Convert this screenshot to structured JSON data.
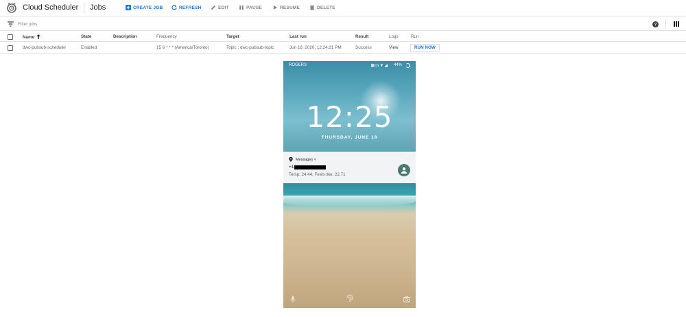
{
  "header": {
    "product_name": "Cloud Scheduler",
    "page_title": "Jobs",
    "actions": {
      "create": "CREATE JOB",
      "refresh": "REFRESH",
      "edit": "EDIT",
      "pause": "PAUSE",
      "resume": "RESUME",
      "delete": "DELETE"
    }
  },
  "filter": {
    "placeholder": "Filter jobs"
  },
  "table": {
    "columns": {
      "name": "Name",
      "state": "State",
      "description": "Description",
      "frequency": "Frequency",
      "target": "Target",
      "last_run": "Last run",
      "result": "Result",
      "logs": "Logs",
      "run": "Run"
    },
    "rows": [
      {
        "name": "dwc-pubsub-scheduler",
        "state": "Enabled",
        "description": "",
        "frequency": "15 6 * * * (America/Toronto)",
        "target": "Topic : dwc-pubsub-topic",
        "last_run": "Jun 18, 2020, 12:24:21 PM",
        "result": "Success",
        "logs": "View",
        "run": "RUN NOW"
      }
    ]
  },
  "phone": {
    "carrier": "ROGERS",
    "battery": "44%",
    "time": "12:25",
    "date": "THURSDAY, JUNE 18",
    "notification": {
      "app": "Messages ˅",
      "sender_prefix": "+1",
      "body": "Temp: 24.44, Feels like: 22.71"
    }
  },
  "colors": {
    "accent": "#1a73e8",
    "disabled": "#80868b",
    "border": "#e0e0e0"
  }
}
